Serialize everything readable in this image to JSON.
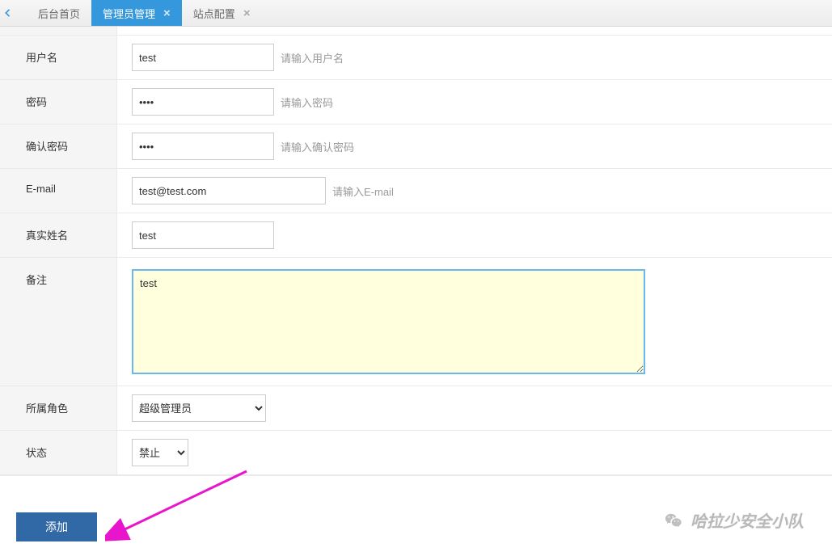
{
  "tabs": [
    {
      "label": "后台首页",
      "closable": false,
      "active": false
    },
    {
      "label": "管理员管理",
      "closable": true,
      "active": true
    },
    {
      "label": "站点配置",
      "closable": true,
      "active": false
    }
  ],
  "form": {
    "username": {
      "label": "用户名",
      "value": "test",
      "hint": "请输入用户名"
    },
    "password": {
      "label": "密码",
      "value": "test",
      "hint": "请输入密码"
    },
    "confirm_password": {
      "label": "确认密码",
      "value": "test",
      "hint": "请输入确认密码"
    },
    "email": {
      "label": "E-mail",
      "value": "test@test.com",
      "hint": "请输入E-mail"
    },
    "realname": {
      "label": "真实姓名",
      "value": "test"
    },
    "remark": {
      "label": "备注",
      "value": "test"
    },
    "role": {
      "label": "所属角色",
      "selected": "超级管理员"
    },
    "status": {
      "label": "状态",
      "selected": "禁止"
    }
  },
  "actions": {
    "submit_label": "添加"
  },
  "watermark": {
    "text": "哈拉少安全小队"
  }
}
